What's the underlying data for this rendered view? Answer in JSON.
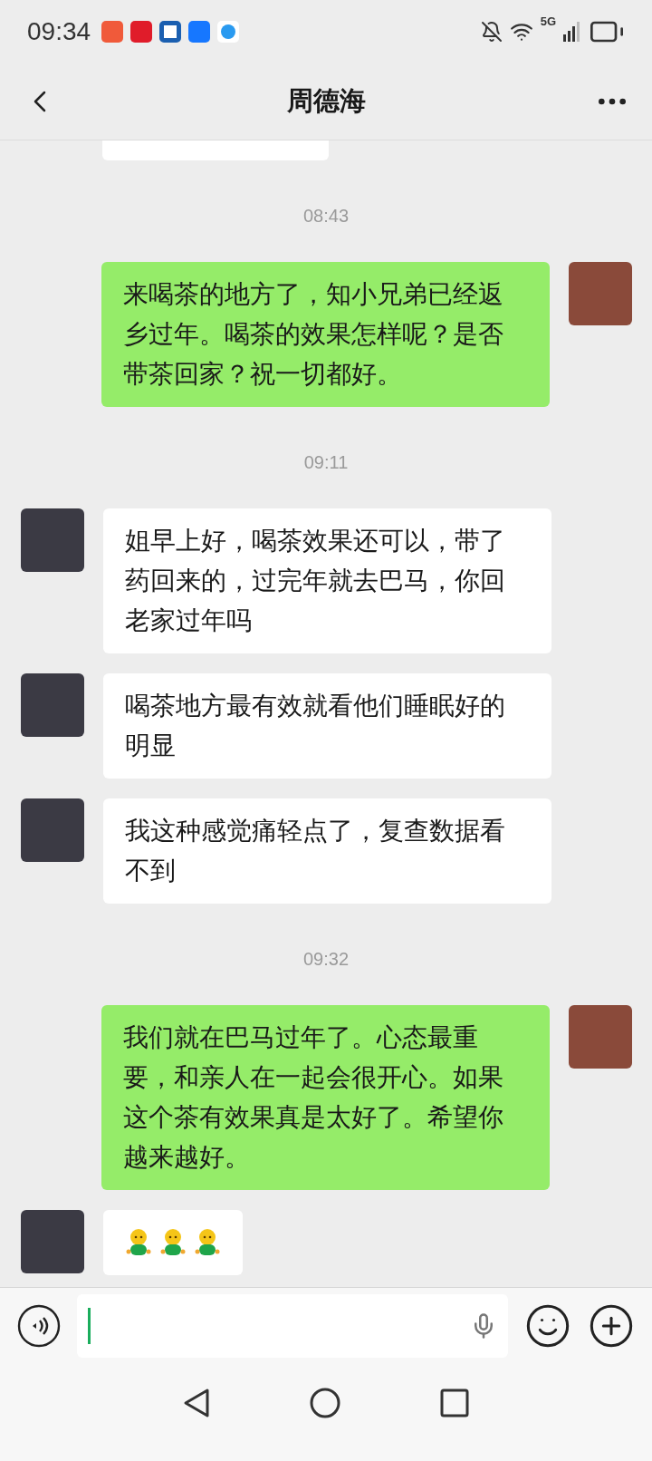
{
  "status_bar": {
    "time": "09:34",
    "network": "5G"
  },
  "header": {
    "title": "周德海"
  },
  "messages": [
    {
      "kind": "time",
      "text": "08:43"
    },
    {
      "kind": "sent",
      "text": "来喝茶的地方了，知小兄弟已经返乡过年。喝茶的效果怎样呢？是否带茶回家？祝一切都好。"
    },
    {
      "kind": "time",
      "text": "09:11"
    },
    {
      "kind": "received",
      "text": "姐早上好，喝茶效果还可以，带了药回来的，过完年就去巴马，你回老家过年吗"
    },
    {
      "kind": "received",
      "text": "喝茶地方最有效就看他们睡眠好的明显"
    },
    {
      "kind": "received",
      "text": "我这种感觉痛轻点了，复查数据看不到"
    },
    {
      "kind": "time",
      "text": "09:32"
    },
    {
      "kind": "sent",
      "text": "我们就在巴马过年了。心态最重要，和亲人在一起会很开心。如果这个茶有效果真是太好了。希望你越来越好。"
    },
    {
      "kind": "emoji",
      "emojis": [
        {
          "kind": "figure"
        },
        {
          "kind": "figure"
        },
        {
          "kind": "figure"
        }
      ]
    }
  ]
}
